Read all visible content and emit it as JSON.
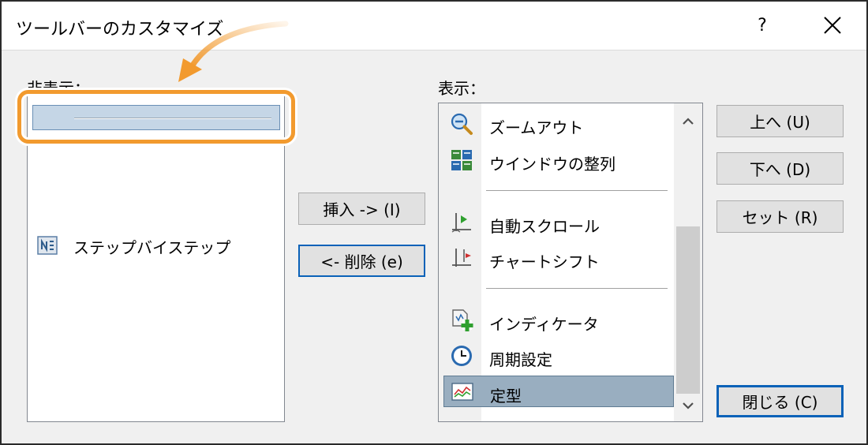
{
  "window": {
    "title": "ツールバーのカスタマイズ",
    "help_label": "?",
    "close_icon": "close-icon"
  },
  "hidden_panel": {
    "label": "非表示：",
    "separator_selected": true,
    "items": [
      {
        "label": "ステップバイステップ",
        "icon": "step-by-step-icon"
      }
    ]
  },
  "callout_color": "#f29a2e",
  "buttons": {
    "insert": "挿入 -> (I)",
    "delete": "<- 削除 (e)",
    "up": "上へ (U)",
    "down": "下へ (D)",
    "reset": "セット (R)",
    "close": "閉じる (C)"
  },
  "shown_panel": {
    "label": "表示：",
    "items": [
      {
        "label": "ズームアウト",
        "icon": "zoom-out-icon"
      },
      {
        "label": "ウインドウの整列",
        "icon": "tile-windows-icon"
      },
      {
        "separator": true
      },
      {
        "label": "自動スクロール",
        "icon": "auto-scroll-icon"
      },
      {
        "label": "チャートシフト",
        "icon": "chart-shift-icon"
      },
      {
        "separator": true
      },
      {
        "label": "インディケータ",
        "icon": "indicators-icon"
      },
      {
        "label": "周期設定",
        "icon": "periodicity-icon"
      },
      {
        "label": "定型",
        "icon": "templates-icon",
        "selected": true
      }
    ]
  },
  "colors": {
    "accent": "#0a62b8",
    "selection": "#99aec0",
    "separator_selection": "#c5d6e6"
  }
}
